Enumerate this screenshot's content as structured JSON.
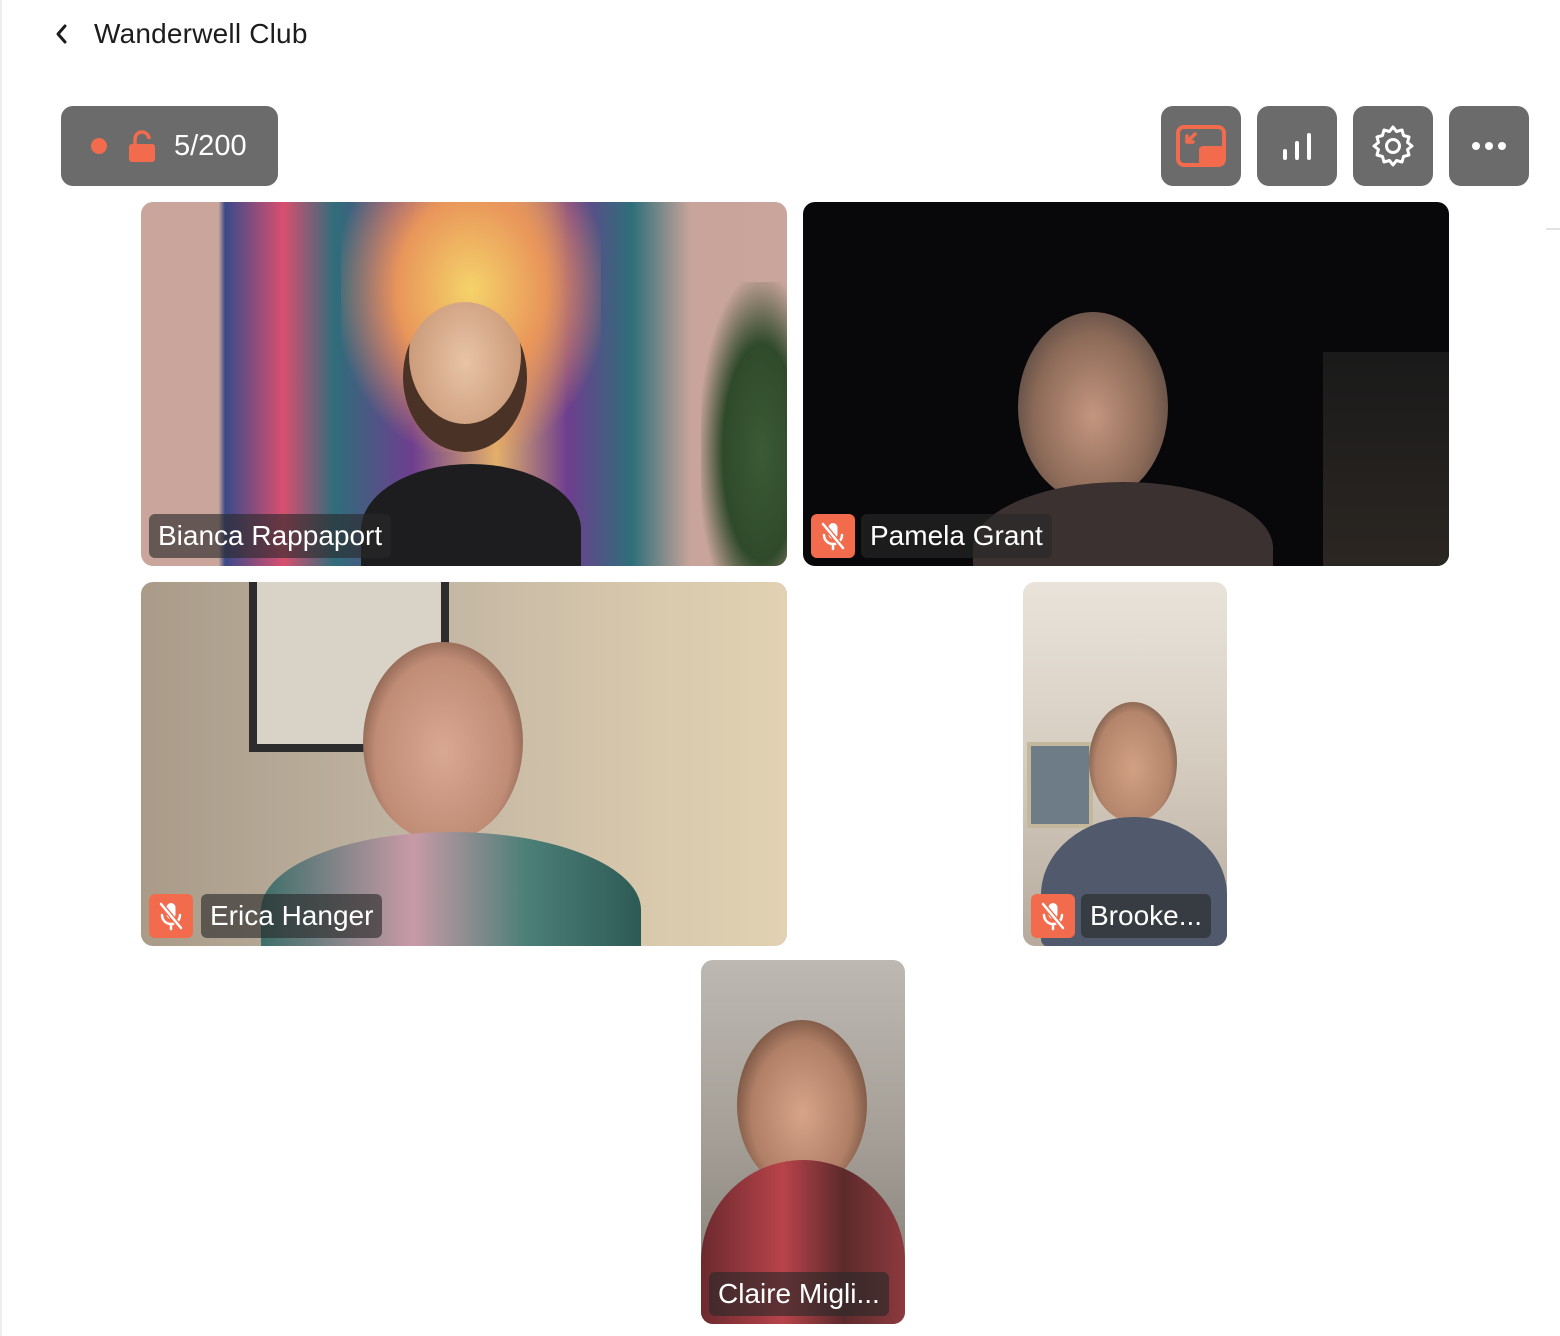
{
  "header": {
    "title": "Wanderwell Club"
  },
  "status": {
    "participant_count": "5/200",
    "recording_color": "#f26b4c"
  },
  "toolbar": {
    "buttons": [
      {
        "icon": "picture-in-picture-icon",
        "active": true
      },
      {
        "icon": "bar-chart-icon"
      },
      {
        "icon": "gear-icon"
      },
      {
        "icon": "more-horizontal-icon"
      }
    ]
  },
  "participants": [
    {
      "name": "Bianca Rappaport",
      "muted": false
    },
    {
      "name": "Pamela Grant",
      "muted": true
    },
    {
      "name": "Erica Hanger",
      "muted": true
    },
    {
      "name": "Brooke...",
      "muted": true
    },
    {
      "name": "Claire Migli...",
      "muted": false
    }
  ],
  "colors": {
    "accent": "#f26b4c",
    "control_bg": "#6b6b6b",
    "background": "#ffffff"
  }
}
